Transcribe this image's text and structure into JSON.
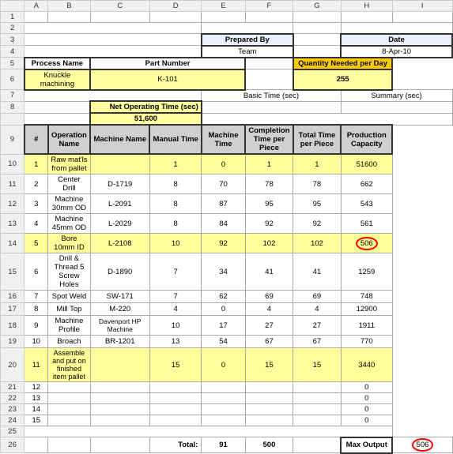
{
  "colHeaders": [
    "",
    "A",
    "B",
    "C",
    "D",
    "E",
    "F",
    "G",
    "H",
    "I"
  ],
  "rows": {
    "r1": {
      "label": "1"
    },
    "r2": {
      "label": "2"
    },
    "r3": {
      "label": "3",
      "preparedBy": "Prepared By",
      "team": "Team",
      "date": "Date",
      "dateVal": "8-Apr-10"
    },
    "r4": {
      "label": "4",
      "processName": "Process Name",
      "partNumber": "Part Number",
      "qtyPerDay": "Quantity Needed per Day"
    },
    "r5": {
      "label": "5",
      "processVal": "Knuckle machining",
      "partVal": "K-101",
      "qty": "255"
    },
    "r6": {
      "label": "6",
      "netOpTime": "Net Operating Time (sec)"
    },
    "r7": {
      "label": "7",
      "netOpVal": "51,600",
      "basicTime": "Basic Time (sec)",
      "summary": "Summary (sec)"
    },
    "r8": {
      "label": "8",
      "basicTimeSub": "Basic Time (sec)",
      "summarySub": "Summary (sec)"
    },
    "r9": {
      "label": "9",
      "colHash": "#",
      "opName": "Operation Name",
      "machName": "Machine Name",
      "manualTime": "Manual Time",
      "machineTime": "Machine Time",
      "completionTime": "Completion Time per Piece",
      "totalTime": "Total Time per Piece",
      "prodCapacity": "Production Capacity"
    },
    "dataRows": [
      {
        "rowNum": "10",
        "num": "1",
        "op": "Raw mat'ls from pallet",
        "mach": "",
        "manual": "1",
        "machine": "0",
        "completion": "1",
        "total": "1",
        "prod": "51600",
        "bg": "yellow"
      },
      {
        "rowNum": "11",
        "num": "2",
        "op": "Center Drill",
        "mach": "D-1719",
        "manual": "8",
        "machine": "70",
        "completion": "78",
        "total": "78",
        "prod": "662",
        "bg": "white"
      },
      {
        "rowNum": "12",
        "num": "3",
        "op": "Machine 30mm OD",
        "mach": "L-2091",
        "manual": "8",
        "machine": "87",
        "completion": "95",
        "total": "95",
        "prod": "543",
        "bg": "white"
      },
      {
        "rowNum": "13",
        "num": "4",
        "op": "Machine 45mm OD",
        "mach": "L-2029",
        "manual": "8",
        "machine": "84",
        "completion": "92",
        "total": "92",
        "prod": "561",
        "bg": "white"
      },
      {
        "rowNum": "14",
        "num": "5",
        "op": "Bore 10mm ID",
        "mach": "L-2108",
        "manual": "10",
        "machine": "92",
        "completion": "102",
        "total": "102",
        "prod": "506",
        "bg": "yellow",
        "circle": true
      },
      {
        "rowNum": "15",
        "num": "6",
        "op": "Drill & Thread 5 Screw Holes",
        "mach": "D-1890",
        "manual": "7",
        "machine": "34",
        "completion": "41",
        "total": "41",
        "prod": "1259",
        "bg": "white"
      },
      {
        "rowNum": "16",
        "num": "7",
        "op": "Spot Weld",
        "mach": "SW-171",
        "manual": "7",
        "machine": "62",
        "completion": "69",
        "total": "69",
        "prod": "748",
        "bg": "white"
      },
      {
        "rowNum": "17",
        "num": "8",
        "op": "Mill Top",
        "mach": "M-220",
        "manual": "4",
        "machine": "0",
        "completion": "4",
        "total": "4",
        "prod": "12900",
        "bg": "white"
      },
      {
        "rowNum": "18",
        "num": "9",
        "op": "Machine Profile",
        "mach": "Davenport HP Machine",
        "manual": "10",
        "machine": "17",
        "completion": "27",
        "total": "27",
        "prod": "1911",
        "bg": "white"
      },
      {
        "rowNum": "19",
        "num": "10",
        "op": "Broach",
        "mach": "BR-1201",
        "manual": "13",
        "machine": "54",
        "completion": "67",
        "total": "67",
        "prod": "770",
        "bg": "white"
      },
      {
        "rowNum": "20",
        "num": "11",
        "op": "Assemble and put on finished item pallet",
        "mach": "",
        "manual": "15",
        "machine": "0",
        "completion": "15",
        "total": "15",
        "prod": "3440",
        "bg": "yellow"
      }
    ],
    "emptyRows": [
      {
        "rowNum": "21",
        "num": "12",
        "prod": "0"
      },
      {
        "rowNum": "22",
        "num": "13",
        "prod": "0"
      },
      {
        "rowNum": "23",
        "num": "14",
        "prod": "0"
      },
      {
        "rowNum": "24",
        "num": "15",
        "prod": "0"
      }
    ],
    "r25": {
      "label": "25"
    },
    "r26": {
      "label": "26",
      "totalLabel": "Total:",
      "totalManual": "91",
      "totalMachine": "500",
      "maxOutput": "Max Output",
      "maxVal": "506"
    }
  }
}
